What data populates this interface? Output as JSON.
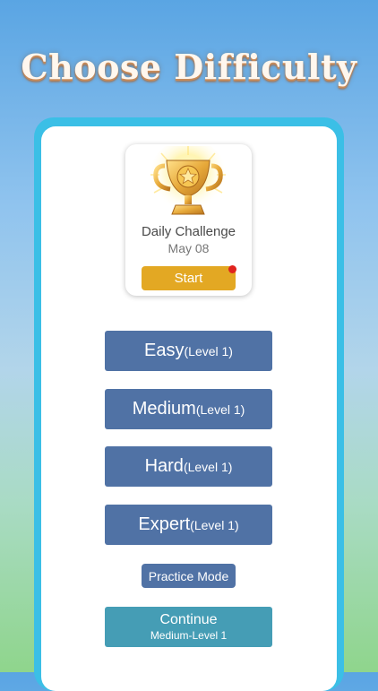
{
  "page_title": "Choose Difficulty",
  "daily_challenge": {
    "title": "Daily Challenge",
    "date": "May 08",
    "start_label": "Start",
    "icon": "trophy-icon"
  },
  "levels": [
    {
      "name": "Easy",
      "level": "(Level 1)"
    },
    {
      "name": "Medium",
      "level": "(Level 1)"
    },
    {
      "name": "Hard",
      "level": "(Level 1)"
    },
    {
      "name": "Expert",
      "level": "(Level 1)"
    }
  ],
  "practice_label": "Practice Mode",
  "continue": {
    "label": "Continue",
    "detail": "Medium-Level 1"
  },
  "colors": {
    "level_button": "#5072a5",
    "continue_button": "#459db5",
    "start_button": "#e3a823",
    "panel_border": "#3bbfe6",
    "notification_dot": "#e0231e"
  }
}
